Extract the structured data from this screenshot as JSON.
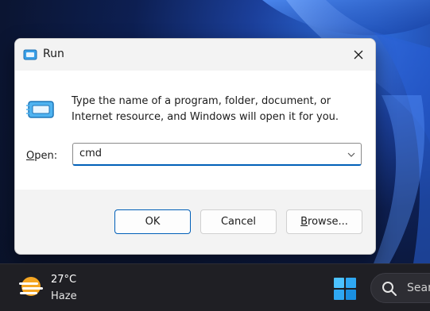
{
  "dialog": {
    "title": "Run",
    "description": "Type the name of a program, folder, document, or Internet resource, and Windows will open it for you.",
    "open_label_accel": "O",
    "open_label_rest": "pen:",
    "open_value": "cmd",
    "buttons": {
      "ok": "OK",
      "cancel": "Cancel",
      "browse_accel": "B",
      "browse_rest": "rowse..."
    }
  },
  "taskbar": {
    "weather": {
      "temperature": "27°C",
      "condition": "Haze",
      "icon": "haze-sun-icon"
    },
    "search": {
      "placeholder": "Sear"
    }
  },
  "colors": {
    "accent": "#005fb8",
    "taskbar_bg": "#1f1f24",
    "dialog_bg": "#f3f3f3",
    "weather_orange": "#f5a623"
  }
}
